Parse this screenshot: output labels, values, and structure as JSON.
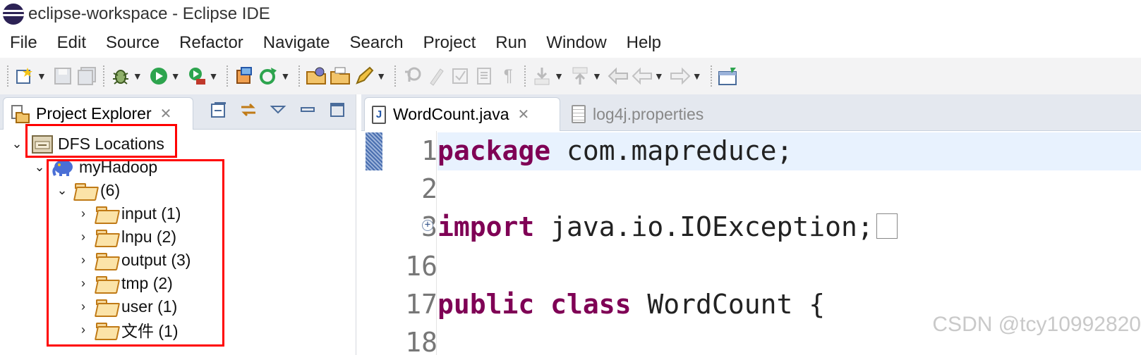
{
  "window": {
    "title": "eclipse-workspace - Eclipse IDE"
  },
  "menu": [
    "File",
    "Edit",
    "Source",
    "Refactor",
    "Navigate",
    "Search",
    "Project",
    "Run",
    "Window",
    "Help"
  ],
  "toolbar": {
    "icons": [
      "new-wizard-icon",
      "save-icon",
      "save-all-icon",
      "debug-icon",
      "run-icon",
      "run-external-tool-icon",
      "open-type-icon",
      "refresh-icon",
      "open-project-icon",
      "open-folder-icon",
      "edit-pencil-icon",
      "search-icon",
      "highlight-icon",
      "toggle-format-icon",
      "block-select-icon",
      "show-whitespace-icon",
      "next-annotation-icon",
      "previous-annotation-icon",
      "last-edit-icon",
      "back-icon",
      "forward-icon",
      "open-perspective-icon"
    ]
  },
  "project_explorer": {
    "tab_label": "Project Explorer",
    "tree": {
      "root": "DFS Locations",
      "location": "myHadoop",
      "folder": "(6)",
      "children": [
        "input (1)",
        "lnpu (2)",
        "output (3)",
        "tmp (2)",
        "user (1)",
        "文件 (1)"
      ]
    }
  },
  "editor": {
    "tabs": [
      {
        "label": "WordCount.java",
        "icon": "java-file-icon",
        "active": true
      },
      {
        "label": "log4j.properties",
        "icon": "properties-file-icon",
        "active": false
      }
    ],
    "lines": [
      {
        "num": "1",
        "kw": "package",
        "rest": " com.mapreduce;"
      },
      {
        "num": "2",
        "kw": "",
        "rest": ""
      },
      {
        "num": "3",
        "kw": "import",
        "rest": " java.io.IOException;"
      },
      {
        "num": "16",
        "kw": "",
        "rest": ""
      },
      {
        "num": "17",
        "kw": "public class",
        "rest": " WordCount {"
      },
      {
        "num": "18",
        "kw": "",
        "rest": ""
      }
    ]
  },
  "watermark": "CSDN @tcy10992820",
  "colors": {
    "keyword": "#7f0055",
    "highlight_box": "#ff0000",
    "toolbar_bg": "#f3f3f4"
  }
}
